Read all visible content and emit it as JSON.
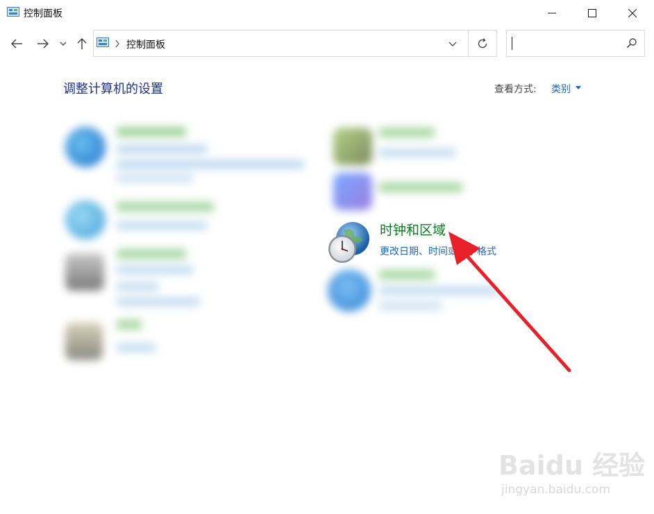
{
  "window": {
    "title": "控制面板",
    "icon": "control-panel-icon"
  },
  "nav": {
    "address_path": "控制面板",
    "search_placeholder": ""
  },
  "content": {
    "heading": "调整计算机的设置",
    "view_by_label": "查看方式:",
    "view_by_value": "类别",
    "highlighted_category": {
      "title": "时钟和区域",
      "subtitle": "更改日期、时间或数字格式",
      "icon": "clock-globe-icon"
    }
  },
  "watermark": {
    "logo": "Baidu 经验",
    "url": "jingyan.baidu.com"
  },
  "colors": {
    "heading": "#1e3287",
    "link": "#1a66c4",
    "category_title": "#0b7a20",
    "arrow": "#e8202a"
  }
}
